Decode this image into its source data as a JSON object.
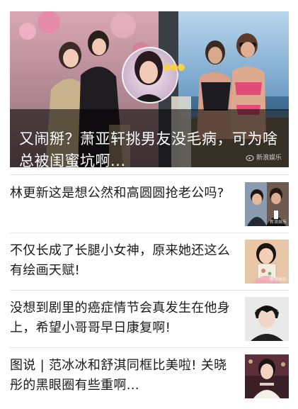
{
  "hero": {
    "title": "又闹掰？萧亚轩挑男友没毛病，可为啥总被闺蜜坑啊...",
    "watermark": "新浪娱乐",
    "emoji_reaction": "😊😊😊",
    "icons": {
      "watermark": "weibo-logo-icon"
    }
  },
  "articles": [
    {
      "title": "林更新这是想公然和高圆圆抢老公吗?",
      "thumbnail_watermark": "新浪娱乐",
      "thumbnail_icon": "two-men-photo-icon"
    },
    {
      "title": "不仅长成了长腿小女神，原来她还这么有绘画天赋!",
      "thumbnail_watermark": "新浪娱乐",
      "thumbnail_icon": "girl-holding-drawing-icon"
    },
    {
      "title": "没想到剧里的癌症情节会真发生在他身上，希望小哥哥早日康复啊!",
      "thumbnail_watermark": "",
      "thumbnail_icon": "young-man-portrait-icon"
    },
    {
      "title": "图说 | 范冰冰和舒淇同框比美啦! 关晓彤的黑眼圈有些重啊...",
      "thumbnail_watermark": "",
      "thumbnail_icon": "actress-red-carpet-icon"
    }
  ],
  "colors": {
    "text": "#1a1a1a",
    "caption_overlay": "rgba(0,0,0,0.55)",
    "divider": "#e5e5e5",
    "hero_text": "#ffffff"
  }
}
